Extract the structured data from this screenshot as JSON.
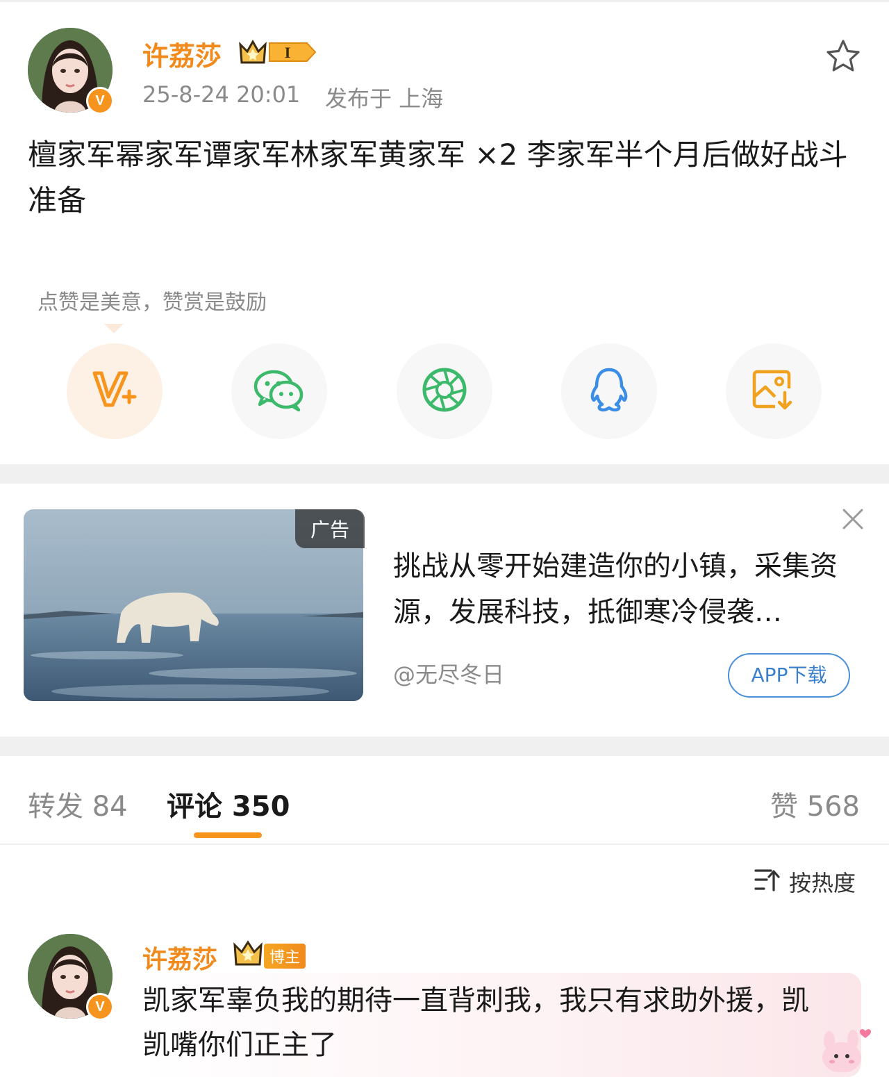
{
  "post": {
    "username": "许荔莎",
    "level_badge": "I",
    "verified_mark": "V",
    "timestamp": "25-8-24 20:01",
    "published_at": "发布于 上海",
    "text": "檀家军幂家军谭家军林家军黄家军 ×2 李家军半个月后做好战斗准备",
    "favorite_icon": "star-outline-icon"
  },
  "reward_tip": "点赞是美意，赞赏是鼓励",
  "share": {
    "items": [
      {
        "icon": "v-plus-icon",
        "color": "#f7941d"
      },
      {
        "icon": "wechat-icon",
        "color": "#3cb96a"
      },
      {
        "icon": "moments-icon",
        "color": "#3cb96a"
      },
      {
        "icon": "qq-icon",
        "color": "#3a8ee6"
      },
      {
        "icon": "save-image-icon",
        "color": "#f0a21e"
      }
    ]
  },
  "ad": {
    "tag": "广告",
    "text": "挑战从零开始建造你的小镇，采集资源，发展科技，抵御寒冷侵袭…",
    "source": "@无尽冬日",
    "button": "APP下载",
    "close_icon": "close-icon"
  },
  "tabs": {
    "repost": "转发 84",
    "comments": "评论 350",
    "likes": "赞 568"
  },
  "sort": {
    "label": "按热度",
    "icon": "sort-icon"
  },
  "comment": {
    "username": "许荔莎",
    "badge": "博主",
    "text": "凯家军辜负我的期待一直背刺我，我只有求助外援，凯凯嘴你们正主了"
  },
  "colors": {
    "accent": "#f7941d",
    "username": "#f08a1c",
    "link_blue": "#3a7fcb"
  }
}
